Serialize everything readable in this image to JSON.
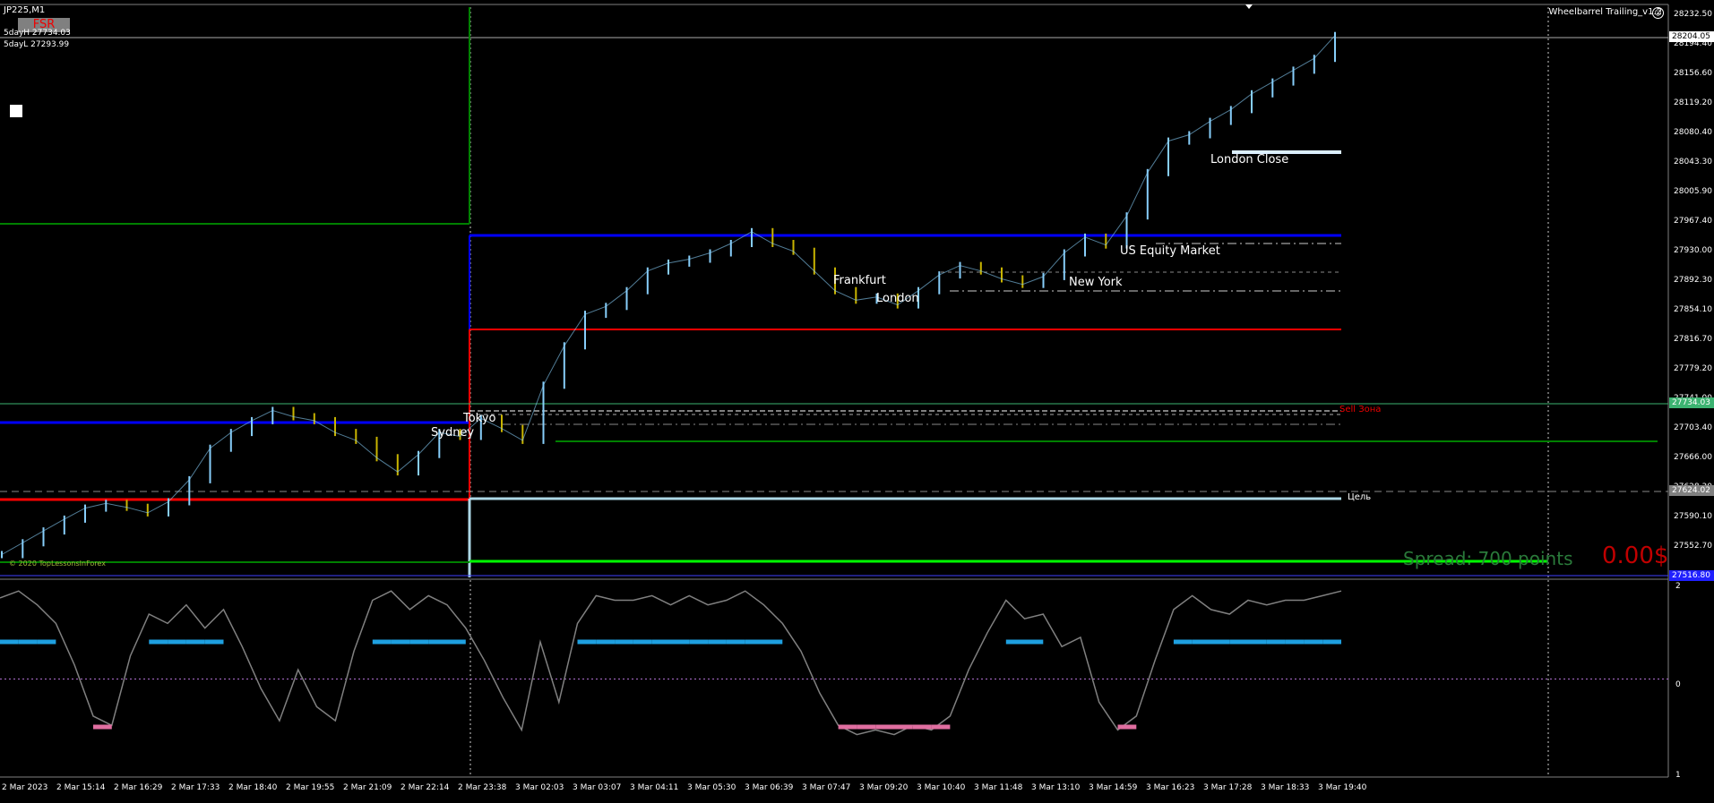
{
  "window": {
    "symbol_label": "JP225,M1",
    "fsr_label": "FSR",
    "day_high_label": "5dayH 27734.03",
    "day_low_label": "5dayL 27293.99",
    "ea_name": "Wheelbarrel Trailing_v1.2",
    "ea_icon": "smiley-icon"
  },
  "info": {
    "spread": "Spread: 700 points",
    "profit": "0.00$",
    "copyright": "© 2020 TopLessonsInForex"
  },
  "sessions": [
    "Tokyo",
    "Sydney",
    "Frankfurt",
    "London",
    "New York",
    "US Equity Market",
    "London Close"
  ],
  "zone_labels": {
    "sell_zone": "Sell Зона",
    "target": "Цель"
  },
  "price_axis": {
    "labels": [
      "28232.50",
      "28194.40",
      "28156.60",
      "28119.20",
      "28080.40",
      "28043.30",
      "28005.90",
      "27967.40",
      "27930.00",
      "27892.30",
      "27854.10",
      "27816.70",
      "27779.20",
      "27741.00",
      "27703.40",
      "27666.00",
      "27628.30",
      "27590.10",
      "27552.70"
    ],
    "current_price": "28204.05",
    "level_high": "27734.03",
    "level_mid": "27624.02",
    "level_low": "27516.80"
  },
  "indicator_axis": {
    "labels": [
      "2",
      "0",
      "1"
    ]
  },
  "time_axis": [
    "2 Mar 2023",
    "2 Mar 15:14",
    "2 Mar 16:29",
    "2 Mar 17:33",
    "2 Mar 18:40",
    "2 Mar 19:55",
    "2 Mar 21:09",
    "2 Mar 22:14",
    "2 Mar 23:38",
    "3 Mar 02:03",
    "3 Mar 03:07",
    "3 Mar 04:11",
    "3 Mar 05:30",
    "3 Mar 06:39",
    "3 Mar 07:47",
    "3 Mar 09:20",
    "3 Mar 10:40",
    "3 Mar 11:48",
    "3 Mar 13:10",
    "3 Mar 14:59",
    "3 Mar 16:23",
    "3 Mar 17:28",
    "3 Mar 18:33",
    "3 Mar 19:40"
  ],
  "colors": {
    "background": "#000000",
    "bull_candle": "#87cefa",
    "bear_candle": "#c8b400",
    "blue_level": "#0000ff",
    "red_level": "#ff0000",
    "green_level": "#008000",
    "lime_level": "#00ff00",
    "target_level": "#add8e6",
    "indicator_line": "#808080",
    "indicator_high": "#1ea0e0",
    "indicator_low": "#e06ea0"
  },
  "chart_data": {
    "type": "line",
    "series": [
      {
        "values": [
          27545,
          27560,
          27575,
          27590,
          27604,
          27610,
          27605,
          27598,
          27612,
          27640,
          27680,
          27700,
          27715,
          27728,
          27720,
          27715,
          27700,
          27690,
          27668,
          27650,
          27672,
          27700,
          27695,
          27718,
          27705,
          27690,
          27760,
          27810,
          27850,
          27860,
          27880,
          27905,
          27915,
          27920,
          27928,
          27940,
          27955,
          27940,
          27930,
          27905,
          27880,
          27868,
          27872,
          27862,
          27880,
          27900,
          27912,
          27905,
          27895,
          27888,
          27898,
          27928,
          27948,
          27938,
          27975,
          28030,
          28070,
          28078,
          28095,
          28110,
          28130,
          28145,
          28160,
          28175,
          28204
        ]
      }
    ],
    "ylim": [
      27516,
      28240
    ],
    "indicator": {
      "values": [
        1.75,
        1.9,
        1.6,
        1.2,
        0.3,
        -0.8,
        -1.0,
        0.5,
        1.4,
        1.2,
        1.6,
        1.1,
        1.5,
        0.7,
        -0.2,
        -0.9,
        0.2,
        -0.6,
        -0.9,
        0.6,
        1.7,
        1.9,
        1.5,
        1.8,
        1.6,
        1.1,
        0.4,
        -0.4,
        -1.1,
        0.8,
        -0.5,
        1.2,
        1.8,
        1.7,
        1.7,
        1.8,
        1.6,
        1.8,
        1.6,
        1.7,
        1.9,
        1.6,
        1.2,
        0.6,
        -0.3,
        -1.0,
        -1.2,
        -1.1,
        -1.2,
        -1.0,
        -1.1,
        -0.8,
        0.2,
        1.0,
        1.7,
        1.3,
        1.4,
        0.7,
        0.9,
        -0.5,
        -1.1,
        -0.8,
        0.4,
        1.5,
        1.8,
        1.5,
        1.4,
        1.7,
        1.6,
        1.7,
        1.7,
        1.8,
        1.9
      ],
      "ylim": [
        -2,
        2
      ]
    }
  }
}
